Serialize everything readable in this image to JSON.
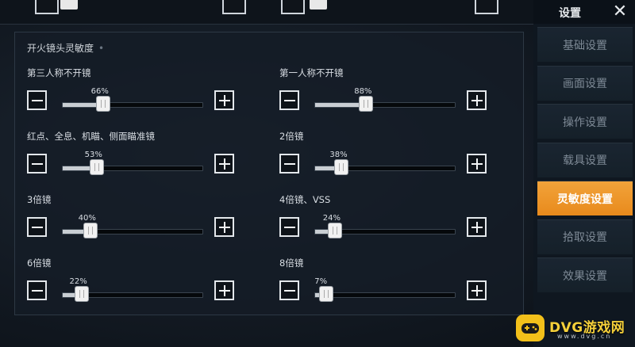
{
  "section_title": "开火镜头灵敏度",
  "sliders": [
    {
      "label": "第三人称不开镜",
      "percent_label": "66%",
      "value": 66
    },
    {
      "label": "第一人称不开镜",
      "percent_label": "88%",
      "value": 88
    },
    {
      "label": "红点、全息、机瞄、侧面瞄准镜",
      "percent_label": "53%",
      "value": 53
    },
    {
      "label": "2倍镜",
      "percent_label": "38%",
      "value": 38
    },
    {
      "label": "3倍镜",
      "percent_label": "40%",
      "value": 40
    },
    {
      "label": "4倍镜、VSS",
      "percent_label": "24%",
      "value": 24
    },
    {
      "label": "6倍镜",
      "percent_label": "22%",
      "value": 22
    },
    {
      "label": "8倍镜",
      "percent_label": "7%",
      "value": 7
    }
  ],
  "nav": {
    "title": "设置",
    "close_glyph": "✕",
    "items": [
      {
        "label": "基础设置",
        "active": false
      },
      {
        "label": "画面设置",
        "active": false
      },
      {
        "label": "操作设置",
        "active": false
      },
      {
        "label": "载具设置",
        "active": false
      },
      {
        "label": "灵敏度设置",
        "active": true
      },
      {
        "label": "拾取设置",
        "active": false
      },
      {
        "label": "效果设置",
        "active": false
      }
    ]
  },
  "watermark": {
    "brand": "DVG游戏网",
    "domain": "www.dvg.cn",
    "logo_icon": "gamepad-icon"
  },
  "colors": {
    "accent": "#e88a1c",
    "watermark": "#f3c01a"
  }
}
